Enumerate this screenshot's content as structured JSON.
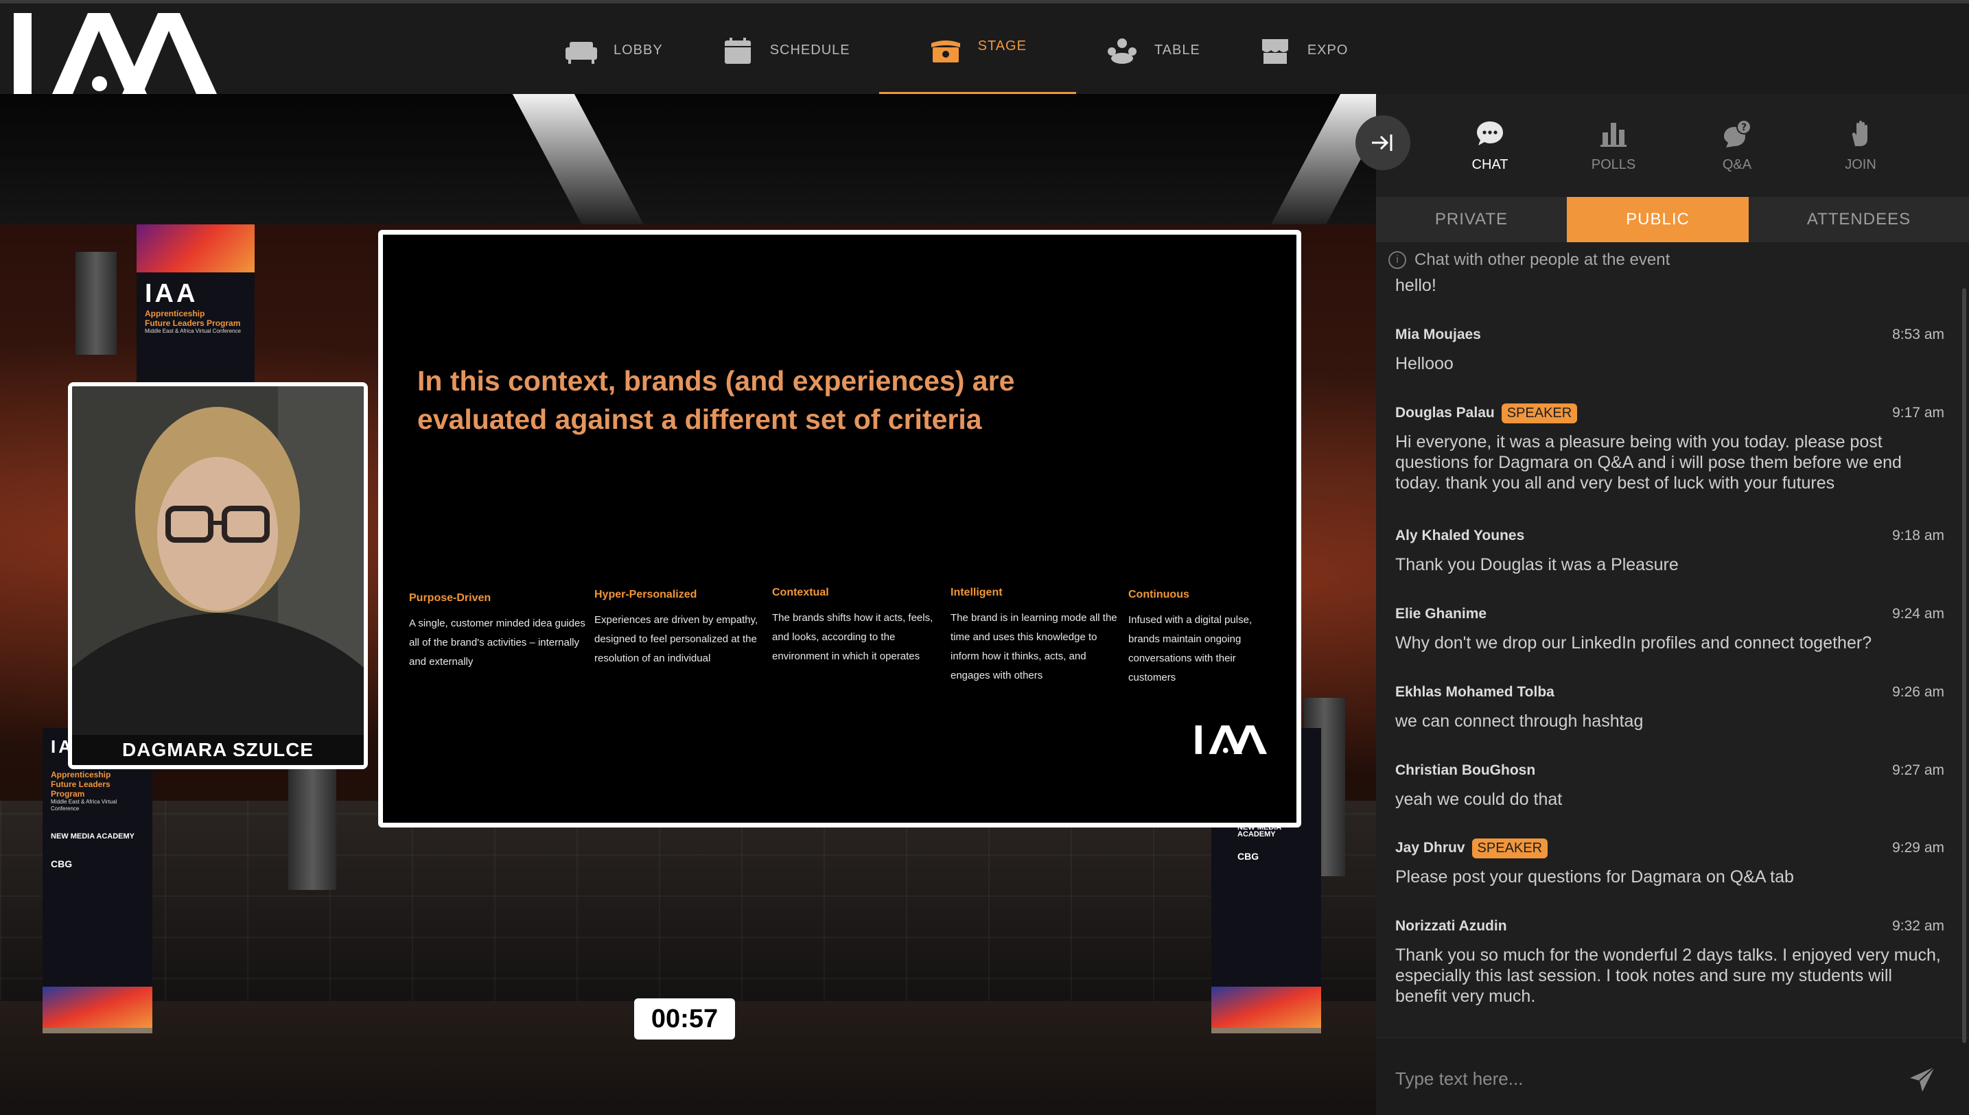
{
  "app": {
    "logo_text": "IAA"
  },
  "nav": {
    "items": [
      {
        "label": "LOBBY",
        "icon": "sofa-icon"
      },
      {
        "label": "SCHEDULE",
        "icon": "calendar-icon"
      },
      {
        "label": "STAGE",
        "icon": "stage-icon",
        "active": true
      },
      {
        "label": "TABLE",
        "icon": "people-table-icon"
      },
      {
        "label": "EXPO",
        "icon": "booth-icon"
      }
    ]
  },
  "stage": {
    "banner": {
      "logo": "IAA",
      "title_line1": "Apprenticeship",
      "title_line2": "Future Leaders Program",
      "subtitle": "Middle East & Africa Virtual Conference",
      "partner": "NEW MEDIA ACADEMY",
      "sponsor": "CBG"
    },
    "speaker_name": "DAGMARA SZULCE",
    "slide": {
      "title": "In this context, brands (and experiences) are evaluated against a different set of criteria",
      "criteria": [
        {
          "heading": "Purpose-Driven",
          "body": "A single, customer minded idea guides all of the brand's activities – internally and externally"
        },
        {
          "heading": "Hyper-Personalized",
          "body": "Experiences are driven by empathy, designed to feel personalized at the  resolution of an individual"
        },
        {
          "heading": "Contextual",
          "body": "The brands shifts how it acts, feels, and looks, according to the environment in which it operates"
        },
        {
          "heading": "Intelligent",
          "body": "The brand is in learning mode all the time and uses this knowledge to  inform how it thinks, acts, and engages with others"
        },
        {
          "heading": "Continuous",
          "body": "Infused with a digital pulse, brands maintain ongoing conversations  with their customers"
        }
      ],
      "logo": "IAA"
    },
    "timer": "00:57"
  },
  "panel": {
    "tabs": [
      {
        "label": "CHAT",
        "icon": "chat-bubble-icon",
        "active": true
      },
      {
        "label": "POLLS",
        "icon": "bar-chart-icon"
      },
      {
        "label": "Q&A",
        "icon": "question-bubble-icon"
      },
      {
        "label": "JOIN",
        "icon": "raised-hand-icon"
      }
    ],
    "segments": [
      {
        "label": "PRIVATE"
      },
      {
        "label": "PUBLIC",
        "active": true
      },
      {
        "label": "ATTENDEES"
      }
    ],
    "info_text": "Chat with other people at the event",
    "messages": [
      {
        "author": "",
        "time": "",
        "text": "hello!"
      },
      {
        "author": "Mia Moujaes",
        "time": "8:53 am",
        "text": "Hellooo"
      },
      {
        "author": "Douglas Palau",
        "badge": "SPEAKER",
        "time": "9:17 am",
        "text": "Hi everyone, it was a pleasure being with you today. please post questions for Dagmara on Q&A and i will pose them before we end today. thank you all and very best of luck with your futures"
      },
      {
        "author": "Aly Khaled Younes",
        "time": "9:18 am",
        "text": "Thank you Douglas it was a Pleasure"
      },
      {
        "author": "Elie Ghanime",
        "time": "9:24 am",
        "text": "Why don't we drop our LinkedIn profiles and connect together?"
      },
      {
        "author": "Ekhlas Mohamed Tolba",
        "time": "9:26 am",
        "text": "we can connect through hashtag"
      },
      {
        "author": "Christian BouGhosn",
        "time": "9:27 am",
        "text": "yeah we could do that"
      },
      {
        "author": "Jay Dhruv",
        "badge": "SPEAKER",
        "time": "9:29 am",
        "text": "Please post your questions for Dagmara on Q&A tab"
      },
      {
        "author": "Norizzati Azudin",
        "time": "9:32 am",
        "text": "Thank you so much for the wonderful 2 days talks. I enjoyed very much, especially this last session. I took notes and sure my students will benefit very much."
      }
    ],
    "composer": {
      "placeholder": "Type text here..."
    }
  },
  "colors": {
    "accent": "#f1963b",
    "panel_bg": "#1f1f1f",
    "topbar_bg": "#1b1b1b"
  }
}
